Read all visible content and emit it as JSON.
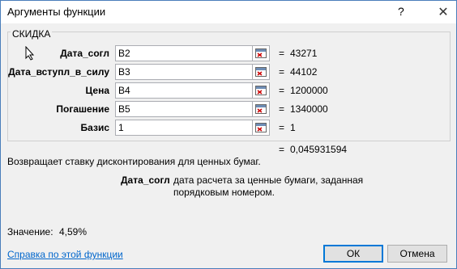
{
  "window": {
    "title": "Аргументы функции",
    "help_label": "?",
    "close_label": "✕"
  },
  "group": {
    "title": "СКИДКА"
  },
  "arguments": [
    {
      "label": "Дата_согл",
      "value": "B2",
      "result": "43271"
    },
    {
      "label": "Дата_вступл_в_силу",
      "value": "B3",
      "result": "44102"
    },
    {
      "label": "Цена",
      "value": "B4",
      "result": "1200000"
    },
    {
      "label": "Погашение",
      "value": "B5",
      "result": "1340000"
    },
    {
      "label": "Базис",
      "value": "1",
      "result": "1"
    }
  ],
  "equals_sign": "=",
  "formula_result": "0,045931594",
  "description": "Возвращает ставку дисконтирования для ценных бумаг.",
  "arg_help": {
    "name": "Дата_согл",
    "text": "дата расчета за ценные бумаги, заданная порядковым номером."
  },
  "value_label": "Значение:",
  "value": "4,59%",
  "help_link": "Справка по этой функции",
  "buttons": {
    "ok": "ОК",
    "cancel": "Отмена"
  },
  "icons": {
    "ref": "collapse-range-icon",
    "cursor": "mouse-cursor-icon"
  }
}
